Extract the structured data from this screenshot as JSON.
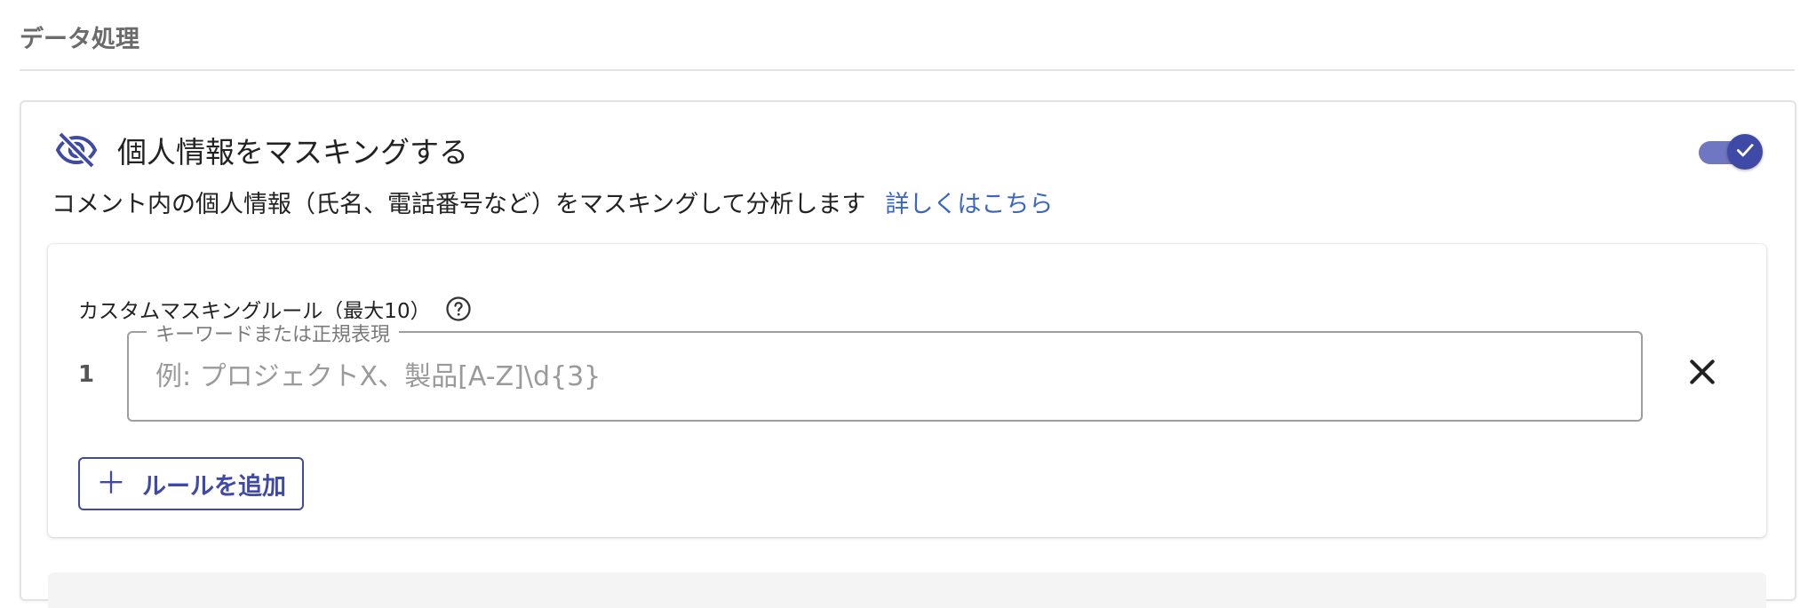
{
  "section": {
    "title": "データ処理"
  },
  "masking": {
    "title": "個人情報をマスキングする",
    "description": "コメント内の個人情報（氏名、電話番号など）をマスキングして分析します",
    "details_link": "詳しくはこちら",
    "enabled": true
  },
  "custom_rules": {
    "label": "カスタムマスキングルール（最大10）",
    "rules": [
      {
        "index": "1",
        "field_label": "キーワードまたは正規表現",
        "value": "",
        "placeholder": "例: プロジェクトX、製品[A-Z]\\d{3}"
      }
    ],
    "add_button_label": "ルールを追加"
  },
  "colors": {
    "primary": "#3f4aa6",
    "link": "#3a66c4",
    "section_title": "#6b6b6b"
  },
  "icons": {
    "masking": "eye-off-icon",
    "help": "help-circle-icon",
    "remove": "close-icon",
    "add": "plus-icon",
    "toggle": "check-icon"
  }
}
